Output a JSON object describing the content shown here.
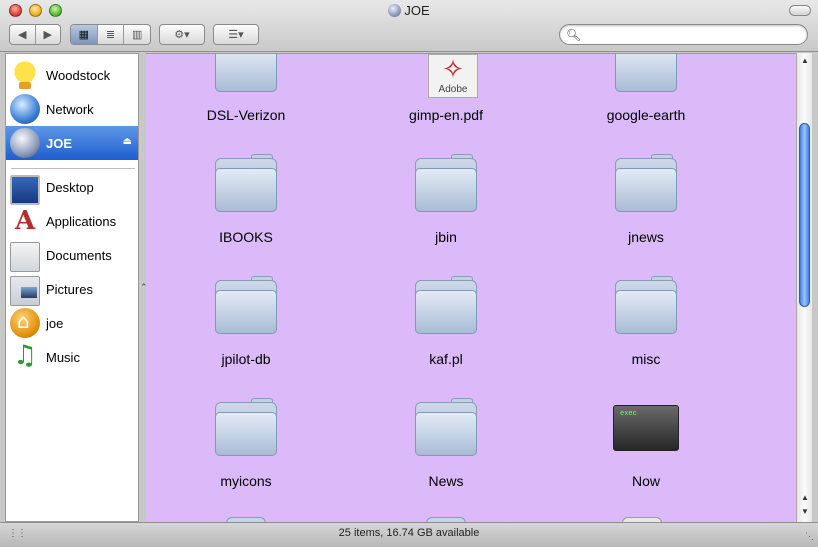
{
  "window": {
    "title": "JOE"
  },
  "toolbar": {
    "back_icon": "◀",
    "forward_icon": "▶",
    "icon_view_icon": "▦",
    "list_view_icon": "≣",
    "column_view_icon": "▥",
    "action_icon": "⚙▾",
    "arrange_icon": "☰▾",
    "search_placeholder": "",
    "search_value": ""
  },
  "sidebar": {
    "items": [
      {
        "label": "Woodstock",
        "icon": "woodstock-icon"
      },
      {
        "label": "Network",
        "icon": "network-globe-icon"
      },
      {
        "label": "JOE",
        "icon": "disk-icon",
        "selected": true,
        "eject": "⏏"
      },
      {
        "label": "Desktop",
        "icon": "desktop-icon"
      },
      {
        "label": "Applications",
        "icon": "applications-icon"
      },
      {
        "label": "Documents",
        "icon": "documents-folder-icon"
      },
      {
        "label": "Pictures",
        "icon": "pictures-folder-icon"
      },
      {
        "label": "joe",
        "icon": "home-icon"
      },
      {
        "label": "Music",
        "icon": "music-icon"
      }
    ]
  },
  "files": [
    {
      "name": "DSL-Verizon",
      "kind": "folder"
    },
    {
      "name": "gimp-en.pdf",
      "kind": "pdf",
      "brand": "Adobe"
    },
    {
      "name": "google-earth",
      "kind": "folder"
    },
    {
      "name": "IBOOKS",
      "kind": "folder"
    },
    {
      "name": "jbin",
      "kind": "folder"
    },
    {
      "name": "jnews",
      "kind": "folder"
    },
    {
      "name": "jpilot-db",
      "kind": "folder"
    },
    {
      "name": "kaf.pl",
      "kind": "folder"
    },
    {
      "name": "misc",
      "kind": "folder"
    },
    {
      "name": "myicons",
      "kind": "folder"
    },
    {
      "name": "News",
      "kind": "folder"
    },
    {
      "name": "Now",
      "kind": "exec",
      "tag": "exec"
    }
  ],
  "status": {
    "text": "25 items, 16.74 GB available"
  },
  "colors": {
    "content_bg": "#dcbaf9",
    "selection": "#1d5fd0"
  }
}
